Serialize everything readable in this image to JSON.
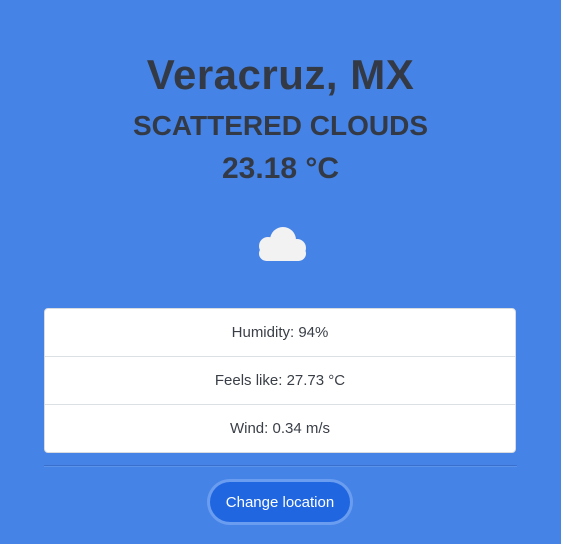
{
  "weather": {
    "city": "Veracruz, MX",
    "condition": "SCATTERED CLOUDS",
    "temperature": "23.18 °C",
    "icon": "cloud-icon"
  },
  "details": [
    {
      "label": "Humidity: 94%"
    },
    {
      "label": "Feels like: 27.73 °C"
    },
    {
      "label": "Wind: 0.34 m/s"
    }
  ],
  "actions": {
    "change_location_label": "Change location"
  },
  "colors": {
    "background": "#4583e6",
    "heading_text": "#333a45",
    "button": "#1f66e0",
    "cloud": "#f2f2f2"
  }
}
